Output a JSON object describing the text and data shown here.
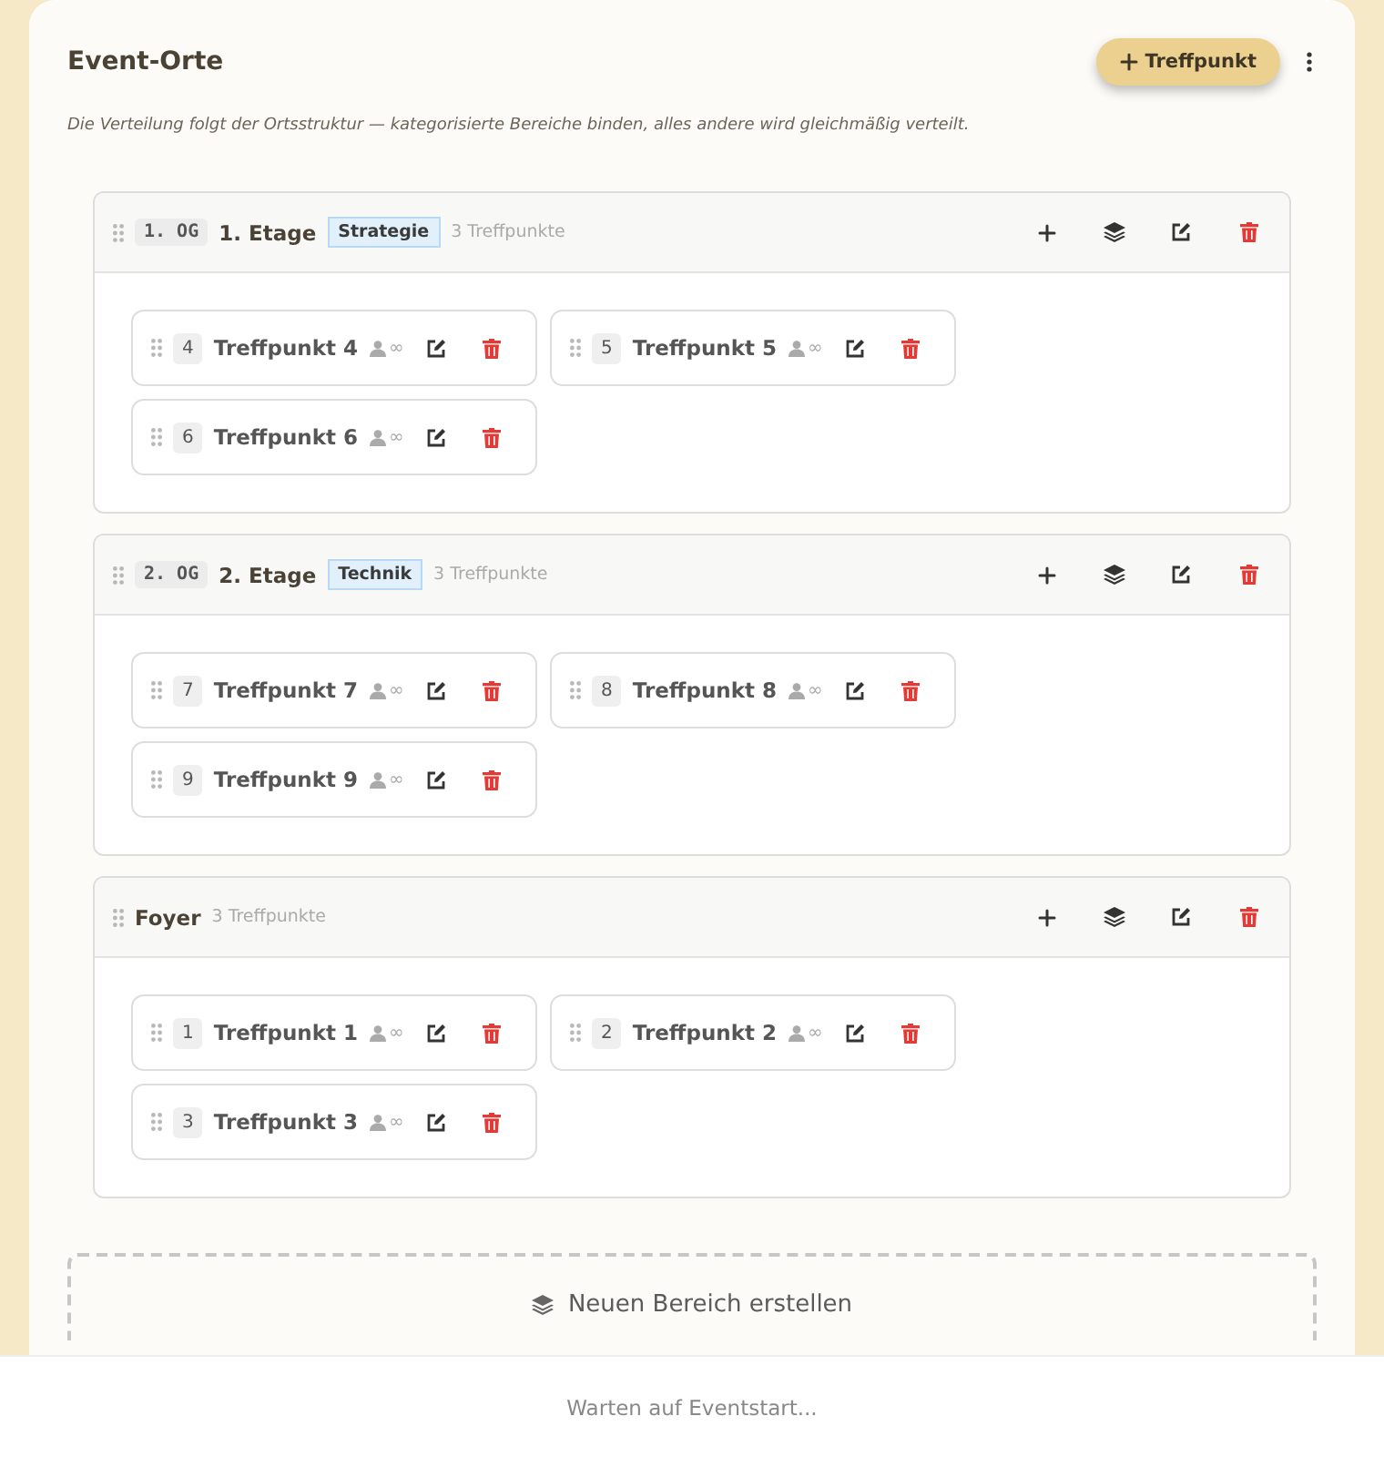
{
  "panel": {
    "title": "Event-Orte",
    "add_button": "Treffpunkt",
    "description": "Die Verteilung folgt der Ortsstruktur — kategorisierte Bereiche binden, alles andere wird gleichmäßig verteilt."
  },
  "groups": [
    {
      "code": "1. OG",
      "name": "1. Etage",
      "tag": "Strategie",
      "count": "3 Treffpunkte",
      "items": [
        {
          "number": "4",
          "name": "Treffpunkt 4",
          "capacity": "∞"
        },
        {
          "number": "5",
          "name": "Treffpunkt 5",
          "capacity": "∞"
        },
        {
          "number": "6",
          "name": "Treffpunkt 6",
          "capacity": "∞"
        }
      ]
    },
    {
      "code": "2. OG",
      "name": "2. Etage",
      "tag": "Technik",
      "count": "3 Treffpunkte",
      "items": [
        {
          "number": "7",
          "name": "Treffpunkt 7",
          "capacity": "∞"
        },
        {
          "number": "8",
          "name": "Treffpunkt 8",
          "capacity": "∞"
        },
        {
          "number": "9",
          "name": "Treffpunkt 9",
          "capacity": "∞"
        }
      ]
    },
    {
      "name": "Foyer",
      "count": "3 Treffpunkte",
      "items": [
        {
          "number": "1",
          "name": "Treffpunkt 1",
          "capacity": "∞"
        },
        {
          "number": "2",
          "name": "Treffpunkt 2",
          "capacity": "∞"
        },
        {
          "number": "3",
          "name": "Treffpunkt 3",
          "capacity": "∞"
        }
      ]
    }
  ],
  "new_area": {
    "label": "Neuen Bereich erstellen"
  },
  "footer": {
    "status": "Warten auf Eventstart..."
  }
}
